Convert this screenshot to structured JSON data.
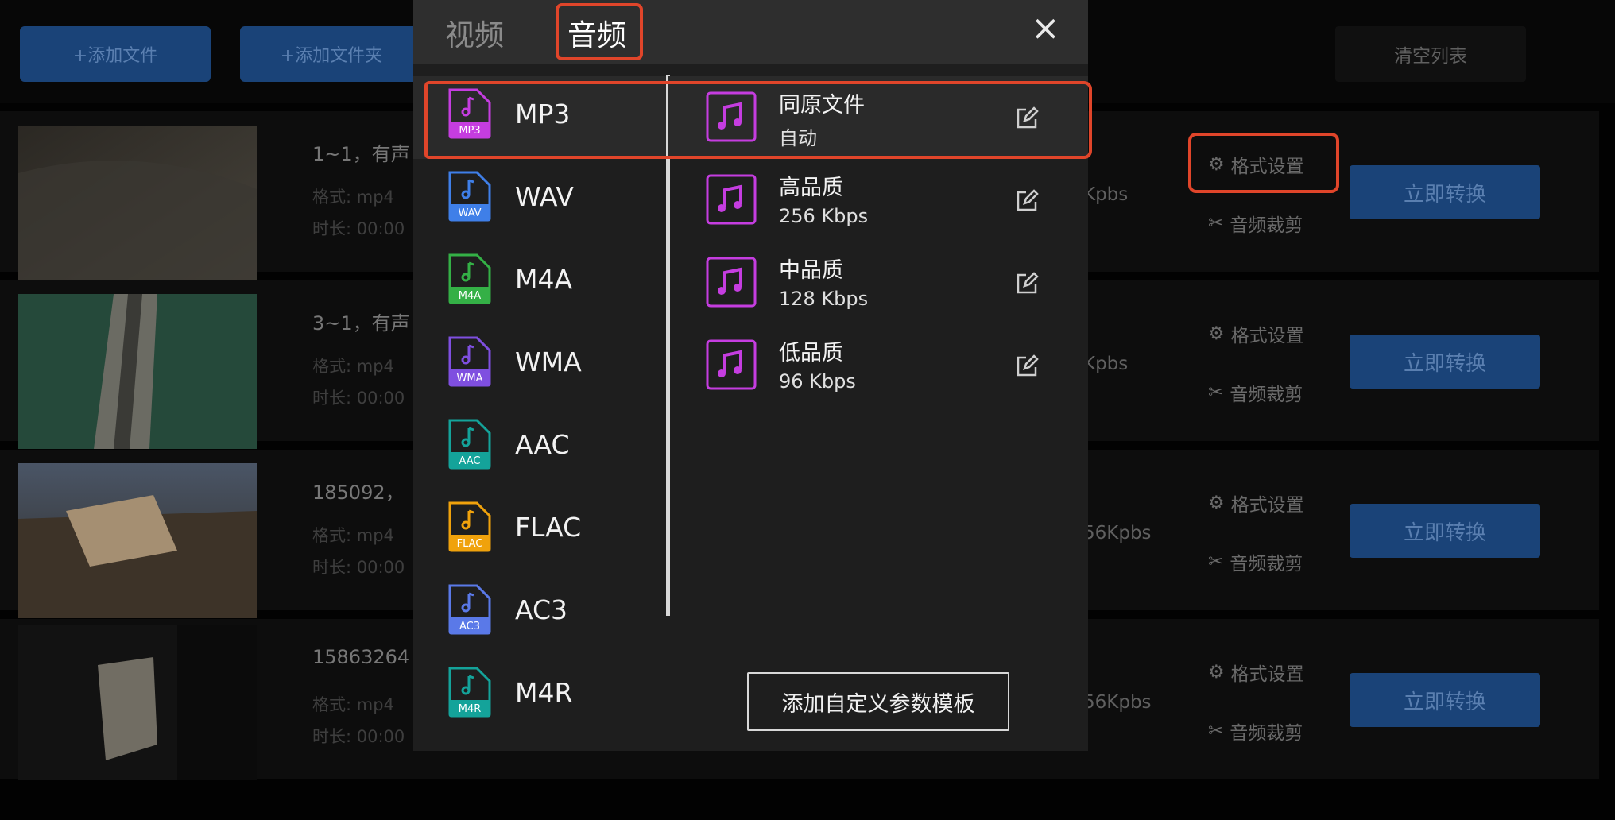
{
  "toolbar": {
    "add_file": "+添加文件",
    "add_folder": "+添加文件夹",
    "clear_list": "清空列表"
  },
  "files": [
    {
      "name": "1~1，有声",
      "format": "格式: mp4",
      "duration": "时长: 00:00",
      "bitrate": "Kpbs"
    },
    {
      "name": "3~1，有声",
      "format": "格式: mp4",
      "duration": "时长: 00:00",
      "bitrate": "Kpbs"
    },
    {
      "name": "185092，",
      "format": "格式: mp4",
      "duration": "时长: 00:00",
      "bitrate": "56Kpbs"
    },
    {
      "name": "15863264",
      "format": "格式: mp4",
      "duration": "时长: 00:00",
      "bitrate": "56Kpbs"
    }
  ],
  "row_actions": {
    "format_settings": "格式设置",
    "audio_trim": "音频裁剪",
    "convert": "立即转换"
  },
  "dialog": {
    "tabs": [
      "视频",
      "音频"
    ],
    "active_tab": "音频",
    "close_icon": "×",
    "formats": [
      {
        "name": "MP3",
        "tag": "MP3",
        "color": "#c53de0"
      },
      {
        "name": "WAV",
        "tag": "WAV",
        "color": "#3f7fe8"
      },
      {
        "name": "M4A",
        "tag": "M4A",
        "color": "#34b046"
      },
      {
        "name": "WMA",
        "tag": "WMA",
        "color": "#7f4fe0"
      },
      {
        "name": "AAC",
        "tag": "AAC",
        "color": "#14a39a"
      },
      {
        "name": "FLAC",
        "tag": "FLAC",
        "color": "#f0a20c"
      },
      {
        "name": "AC3",
        "tag": "AC3",
        "color": "#5a79e8"
      },
      {
        "name": "M4R",
        "tag": "M4R",
        "color": "#14a39a"
      }
    ],
    "selected_format": "MP3",
    "qualities": [
      {
        "title": "同原文件",
        "subtitle": "自动"
      },
      {
        "title": "高品质",
        "subtitle": "256 Kbps"
      },
      {
        "title": "中品质",
        "subtitle": "128 Kbps"
      },
      {
        "title": "低品质",
        "subtitle": "96 Kbps"
      }
    ],
    "add_template": "添加自定义参数模板",
    "accent_color": "#c53de0",
    "highlight_color": "#e0452a"
  }
}
